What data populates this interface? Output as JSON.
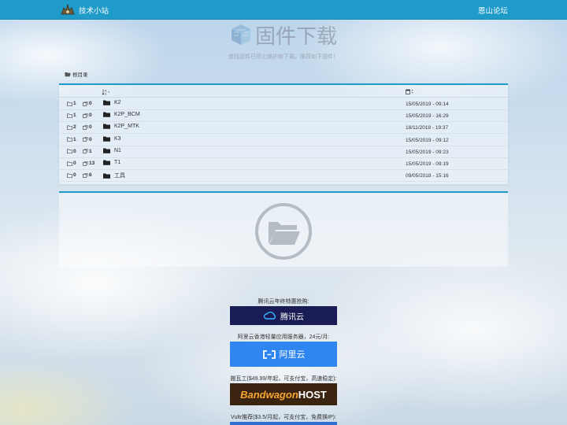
{
  "nav": {
    "brand": "技术小站",
    "right_link": "恩山论坛"
  },
  "hero": {
    "title": "固件下载",
    "subtitle": "查找固件已停止维护和下载，推荐如下固件！"
  },
  "breadcrumb": {
    "label": "根目录"
  },
  "table": {
    "date_header_icon": "calendar-icon",
    "rows": [
      {
        "dirs": "1",
        "files": "0",
        "name": "K2",
        "date": "15/05/2019 - 09:14"
      },
      {
        "dirs": "1",
        "files": "0",
        "name": "K2P_BCM",
        "date": "15/05/2019 - 16:29"
      },
      {
        "dirs": "2",
        "files": "0",
        "name": "K2P_MTK",
        "date": "18/11/2019 - 19:37"
      },
      {
        "dirs": "1",
        "files": "0",
        "name": "K3",
        "date": "15/05/2019 - 09:12"
      },
      {
        "dirs": "0",
        "files": "1",
        "name": "N1",
        "date": "15/05/2019 - 09:23"
      },
      {
        "dirs": "0",
        "files": "13",
        "name": "T1",
        "date": "15/05/2019 - 09:19"
      },
      {
        "dirs": "0",
        "files": "6",
        "name": "工具",
        "date": "09/05/2018 - 15:16"
      }
    ]
  },
  "ads": [
    {
      "label": "腾讯云年终特惠抢购:",
      "banner": "腾讯云"
    },
    {
      "label": "阿里云香港轻量应用服务器，24元/月:",
      "banner": "阿里云"
    },
    {
      "label": "搬瓦工($49.99/年起，可支付宝，高速稳定):",
      "banner": "Bandwagon",
      "banner_suffix": "HOST"
    },
    {
      "label": "Vultr推荐($3.5/月起，可支付宝，免费换IP):",
      "banner": ""
    }
  ],
  "colors": {
    "accent": "#1e9bc8",
    "tencent_banner": "#1a1c55",
    "aliyun_banner": "#2f86f0",
    "bwg_banner": "#3a2410"
  }
}
